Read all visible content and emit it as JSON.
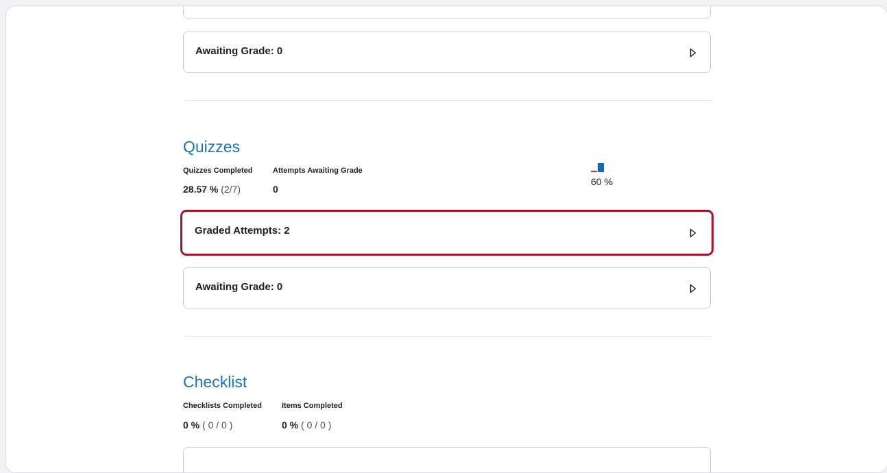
{
  "assignments": {
    "awaiting_grade_label": "Awaiting Grade: 0"
  },
  "quizzes": {
    "title": "Quizzes",
    "stats": [
      {
        "label": "Quizzes Completed",
        "value_bold": "28.57 %",
        "value_extra": "(2/7)"
      },
      {
        "label": "Attempts Awaiting Grade",
        "value_bold": "0",
        "value_extra": ""
      }
    ],
    "class_average": {
      "value_label": "60 %",
      "value": 60,
      "colors": {
        "user": "#d62f2f",
        "class": "#1565c0"
      }
    },
    "graded_attempts_label": "Graded Attempts: 2",
    "awaiting_grade_label": "Awaiting Grade: 0"
  },
  "checklist": {
    "title": "Checklist",
    "stats": [
      {
        "label": "Checklists Completed",
        "value_bold": "0 %",
        "value_extra": "( 0 / 0 )"
      },
      {
        "label": "Items Completed",
        "value_bold": "0 %",
        "value_extra": "( 0 / 0 )"
      }
    ]
  },
  "colors": {
    "accent": "#1a73b8",
    "highlight": "#a6142c"
  },
  "icons": {
    "chevron": "chevron-right-icon"
  }
}
